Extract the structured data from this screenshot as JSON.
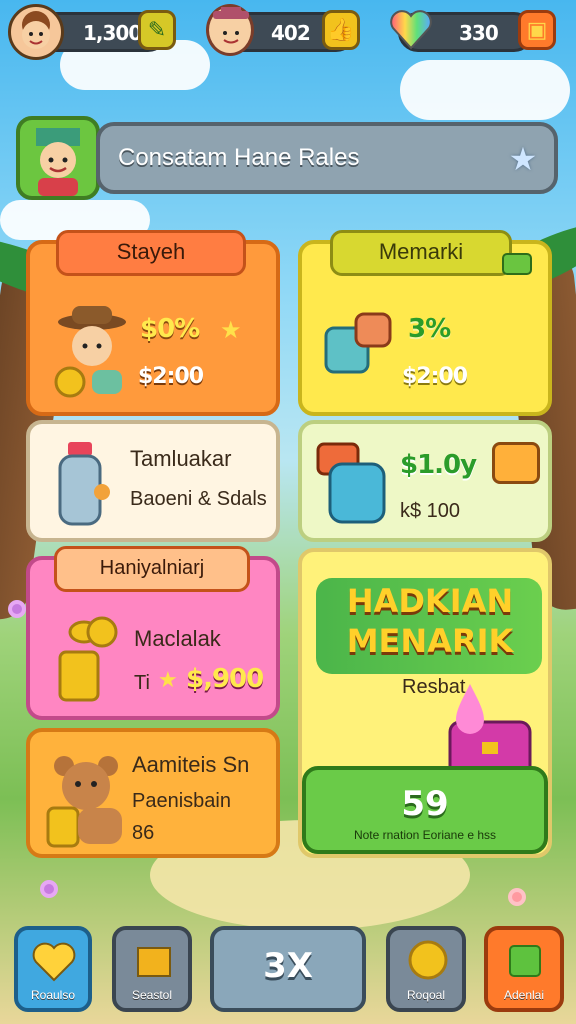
{
  "topbar": {
    "res1": {
      "value": "1,300",
      "avatar_icon": "boy-avatar-icon",
      "button_icon": "leaf-plus-icon"
    },
    "res2": {
      "value": "402",
      "avatar_icon": "cowboy-avatar-icon",
      "button_icon": "thumbs-up-icon"
    },
    "res3": {
      "value": "330",
      "avatar_icon": "rainbow-heart-icon",
      "button_icon": "shop-icon"
    }
  },
  "search": {
    "text": "Consatam Hane Rales",
    "icon": "star-icon"
  },
  "cards": {
    "stayeh": {
      "tag": "Stayeh",
      "discount": "$0%",
      "price": "$2:00"
    },
    "memarki": {
      "tag": "Memarki",
      "discount": "3%",
      "price": "$2:00"
    },
    "tamluakar": {
      "title": "Tamluakar",
      "subtitle": "Baoeni & Sdals"
    },
    "bag": {
      "price": "$1.0y",
      "sub": "k$ 100"
    },
    "haniyaliniarj": {
      "tag": "Haniyalniarj",
      "title": "Maclalak",
      "price": "$,900",
      "prefix": "Ti"
    },
    "promo": {
      "line1": "HADKIAN",
      "line2": "MENARIK",
      "label": "Resbat",
      "count": "59",
      "caption": "Note rnation Eoriane e hss"
    },
    "aamiteis": {
      "title": "Aamiteis Sn",
      "subtitle": "Paenisbain",
      "value": "86"
    }
  },
  "nav": {
    "b1": {
      "label": "Roaulso",
      "icon": "heart-icon"
    },
    "b2": {
      "label": "Seastol",
      "icon": "box-icon"
    },
    "center": {
      "label": "3X"
    },
    "b3": {
      "label": "Roqoal",
      "icon": "coin-icon"
    },
    "b4": {
      "label": "Adenlai",
      "icon": "gift-icon"
    }
  },
  "colors": {
    "orange": "#ff9a3c",
    "yellow": "#ffe94d",
    "pink": "#ff86c2",
    "green": "#5ec23e"
  }
}
